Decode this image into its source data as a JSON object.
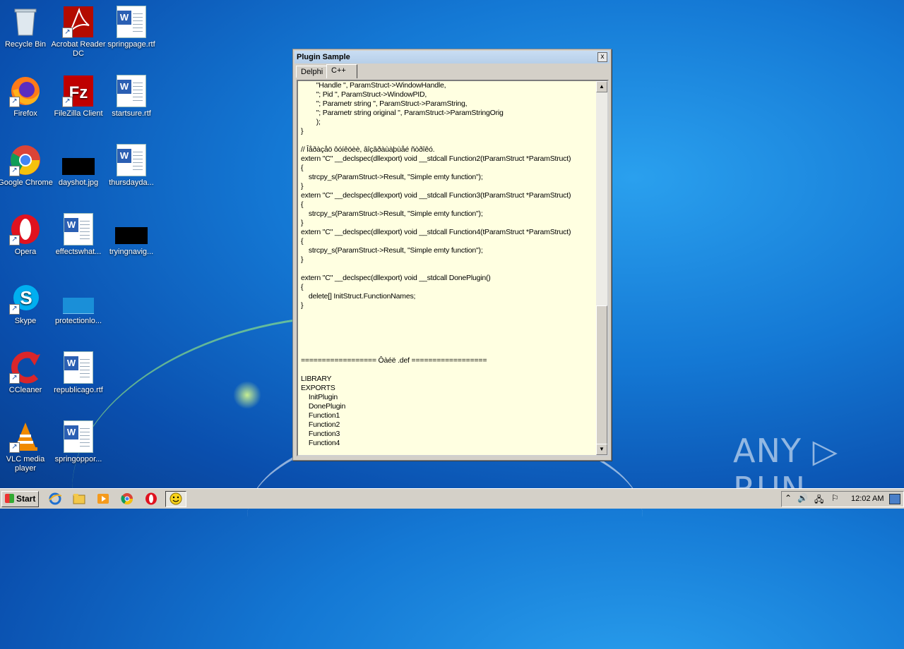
{
  "desktop": {
    "icons": [
      {
        "label": "Recycle Bin",
        "icon": "recycle-bin-icon"
      },
      {
        "label": "Acrobat Reader DC",
        "icon": "acrobat-icon"
      },
      {
        "label": "springpage.rtf",
        "icon": "word-doc-icon"
      },
      {
        "label": "Firefox",
        "icon": "firefox-icon"
      },
      {
        "label": "FileZilla Client",
        "icon": "filezilla-icon"
      },
      {
        "label": "startsure.rtf",
        "icon": "word-doc-icon"
      },
      {
        "label": "Google Chrome",
        "icon": "chrome-icon"
      },
      {
        "label": "dayshot.jpg",
        "icon": "image-file-icon"
      },
      {
        "label": "thursdayda...",
        "icon": "word-doc-icon"
      },
      {
        "label": "Opera",
        "icon": "opera-icon"
      },
      {
        "label": "effectswhat...",
        "icon": "word-doc-icon"
      },
      {
        "label": "tryingnavig...",
        "icon": "image-file-icon"
      },
      {
        "label": "Skype",
        "icon": "skype-icon"
      },
      {
        "label": "protectionlo...",
        "icon": "file-icon"
      },
      {
        "label": "CCleaner",
        "icon": "ccleaner-icon"
      },
      {
        "label": "republicago.rtf",
        "icon": "word-doc-icon"
      },
      {
        "label": "VLC media player",
        "icon": "vlc-icon"
      },
      {
        "label": "springoppor...",
        "icon": "word-doc-icon"
      }
    ]
  },
  "window": {
    "title": "Plugin Sample",
    "close_glyph": "x",
    "tabs": [
      "Delphi",
      "C++"
    ],
    "active_tab": "C++",
    "code": "        \"Handle \", ParamStruct->WindowHandle,\n        \"; Pid \", ParamStruct->WindowPID,\n        \"; Parametr string \", ParamStruct->ParamString,\n        \"; Parametr string original \", ParamStruct->ParamStringOrig\n        );\n}\n\n// Îåðàçåö ôóíêöèè, âîçâðàùàþùåé ñòðîêó.\nextern \"C\" __declspec(dllexport) void __stdcall Function2(tParamStruct *ParamStruct)\n{\n    strcpy_s(ParamStruct->Result, \"Simple emty function\");\n}\nextern \"C\" __declspec(dllexport) void __stdcall Function3(tParamStruct *ParamStruct)\n{\n    strcpy_s(ParamStruct->Result, \"Simple emty function\");\n}\nextern \"C\" __declspec(dllexport) void __stdcall Function4(tParamStruct *ParamStruct)\n{\n    strcpy_s(ParamStruct->Result, \"Simple emty function\");\n}\n\nextern \"C\" __declspec(dllexport) void __stdcall DonePlugin()\n{\n    delete[] InitStruct.FunctionNames;\n}\n\n\n\n\n\n================== Ôàéë .def ==================\n\nLIBRARY\nEXPORTS\n    InitPlugin\n    DonePlugin\n    Function1\n    Function2\n    Function3\n    Function4"
  },
  "watermark": "ANY ▷ RUN",
  "taskbar": {
    "start_label": "Start",
    "items": [
      "ie-icon",
      "explorer-icon",
      "media-player-icon",
      "chrome-icon",
      "opera-icon",
      "plugin-sample-icon"
    ],
    "clock": "12:02 AM"
  }
}
